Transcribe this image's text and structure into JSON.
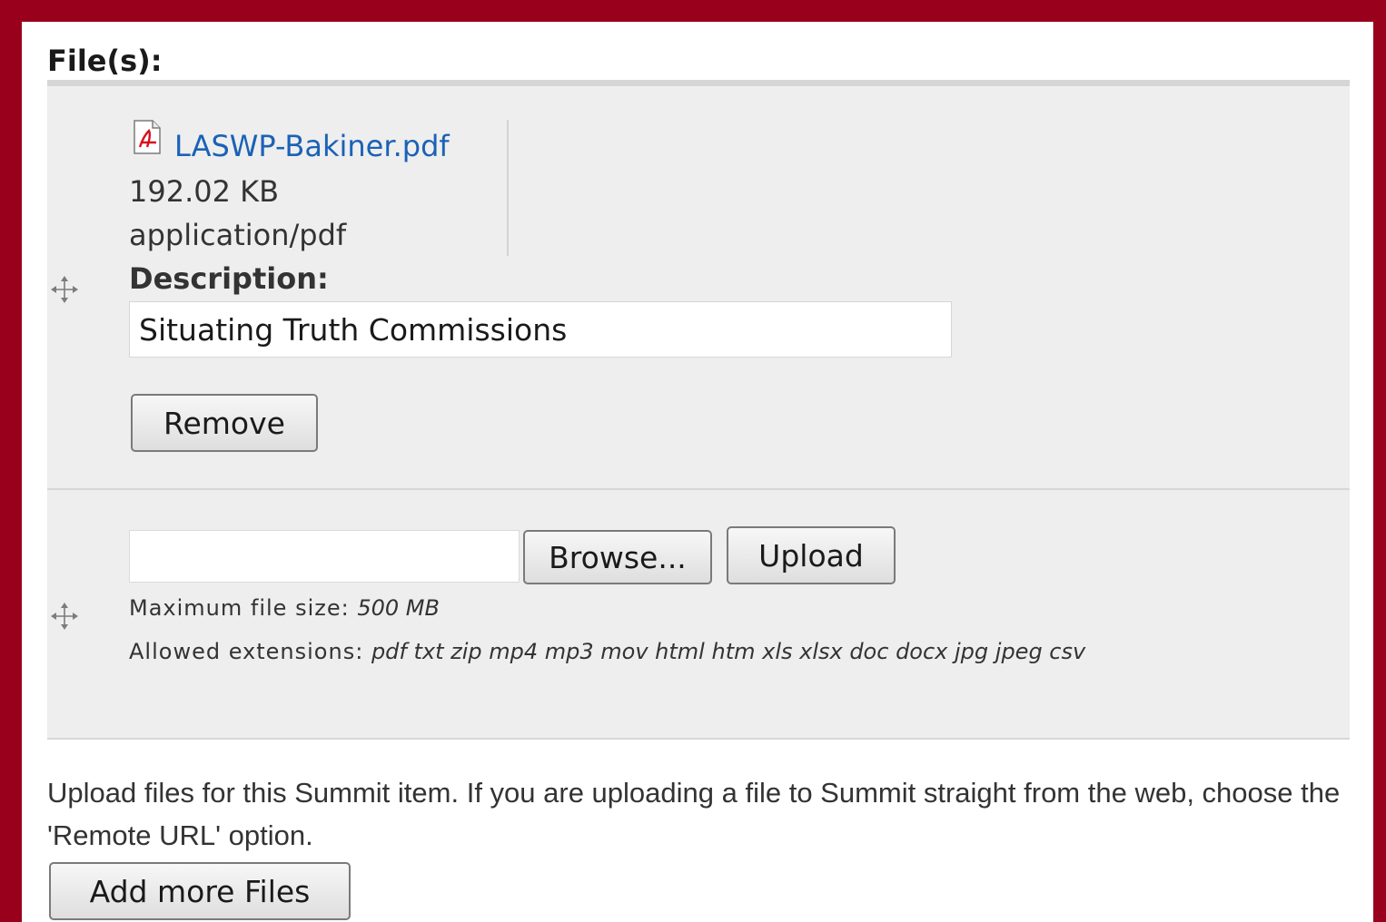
{
  "section": {
    "title": "File(s):"
  },
  "file": {
    "name": "LASWP-Bakiner.pdf",
    "size": "192.02 KB",
    "mime": "application/pdf",
    "icon": "pdf-icon"
  },
  "description": {
    "label": "Description:",
    "value": "Situating Truth Commissions"
  },
  "buttons": {
    "remove": "Remove",
    "browse": "Browse...",
    "upload": "Upload",
    "add_more": "Add more Files"
  },
  "upload_hints": {
    "max_size_label": "Maximum file size:",
    "max_size_value": "500 MB",
    "extensions_label": "Allowed extensions:",
    "extensions_value": "pdf txt zip mp4 mp3 mov html htm xls xlsx doc docx jpg jpeg csv"
  },
  "help_text": "Upload files for this Summit item. If you are uploading a file to Summit straight from the web, choose the 'Remote URL' option.",
  "colors": {
    "frame": "#98001c",
    "link": "#1a62b6",
    "panel_bg": "#eeeeee"
  }
}
